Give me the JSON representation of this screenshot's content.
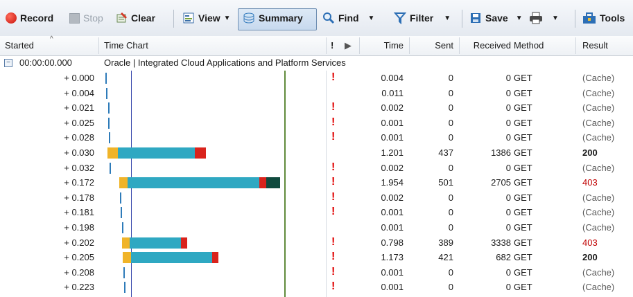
{
  "toolbar": {
    "record": "Record",
    "stop": "Stop",
    "clear": "Clear",
    "view": "View",
    "summary": "Summary",
    "find": "Find",
    "filter": "Filter",
    "save": "Save",
    "tools": "Tools"
  },
  "columns": {
    "started": "Started",
    "time_chart": "Time Chart",
    "flag1": "!",
    "flag2": "▶",
    "time": "Time",
    "sent": "Sent",
    "received": "Received",
    "method": "Method",
    "result": "Result"
  },
  "group": {
    "started": "00:00:00.000",
    "title": "Oracle | Integrated Cloud Applications and Platform Services"
  },
  "rows": [
    {
      "started": "+ 0.000",
      "bang": true,
      "time": "0.004",
      "sent": "0",
      "received": "0",
      "method": "GET",
      "result": "(Cache)"
    },
    {
      "started": "+ 0.004",
      "bang": false,
      "time": "0.011",
      "sent": "0",
      "received": "0",
      "method": "GET",
      "result": "(Cache)"
    },
    {
      "started": "+ 0.021",
      "bang": true,
      "time": "0.002",
      "sent": "0",
      "received": "0",
      "method": "GET",
      "result": "(Cache)"
    },
    {
      "started": "+ 0.025",
      "bang": true,
      "time": "0.001",
      "sent": "0",
      "received": "0",
      "method": "GET",
      "result": "(Cache)"
    },
    {
      "started": "+ 0.028",
      "bang": true,
      "time": "0.001",
      "sent": "0",
      "received": "0",
      "method": "GET",
      "result": "(Cache)"
    },
    {
      "started": "+ 0.030",
      "bang": false,
      "time": "1.201",
      "sent": "437",
      "received": "1386",
      "method": "GET",
      "result": "200"
    },
    {
      "started": "+ 0.032",
      "bang": true,
      "time": "0.002",
      "sent": "0",
      "received": "0",
      "method": "GET",
      "result": "(Cache)"
    },
    {
      "started": "+ 0.172",
      "bang": true,
      "time": "1.954",
      "sent": "501",
      "received": "2705",
      "method": "GET",
      "result": "403"
    },
    {
      "started": "+ 0.178",
      "bang": true,
      "time": "0.002",
      "sent": "0",
      "received": "0",
      "method": "GET",
      "result": "(Cache)"
    },
    {
      "started": "+ 0.181",
      "bang": true,
      "time": "0.001",
      "sent": "0",
      "received": "0",
      "method": "GET",
      "result": "(Cache)"
    },
    {
      "started": "+ 0.198",
      "bang": false,
      "time": "0.001",
      "sent": "0",
      "received": "0",
      "method": "GET",
      "result": "(Cache)"
    },
    {
      "started": "+ 0.202",
      "bang": true,
      "time": "0.798",
      "sent": "389",
      "received": "3338",
      "method": "GET",
      "result": "403"
    },
    {
      "started": "+ 0.205",
      "bang": true,
      "time": "1.173",
      "sent": "421",
      "received": "682",
      "method": "GET",
      "result": "200"
    },
    {
      "started": "+ 0.208",
      "bang": true,
      "time": "0.001",
      "sent": "0",
      "received": "0",
      "method": "GET",
      "result": "(Cache)"
    },
    {
      "started": "+ 0.223",
      "bang": true,
      "time": "0.001",
      "sent": "0",
      "received": "0",
      "method": "GET",
      "result": "(Cache)"
    }
  ],
  "colors": {
    "result_ok": "#1a1a1a",
    "result_forbidden": "#c00000",
    "result_cache": "#5a5a5a",
    "bar_wait": "#f0b429",
    "bar_receive": "#2fa8c2",
    "bar_red": "#d9231c",
    "bar_dark": "#0f4a3e",
    "tick": "#2e7bb9"
  }
}
